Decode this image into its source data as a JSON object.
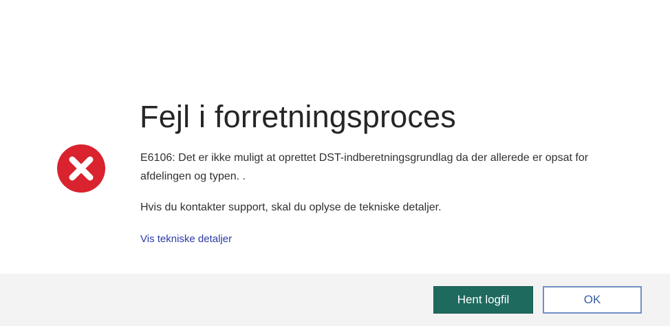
{
  "dialog": {
    "title": "Fejl i forretningsproces",
    "message": "E6106: Det er ikke muligt at oprettet DST-indberetningsgrundlag da der allerede er opsat for afdelingen og typen. .",
    "support_text": "Hvis du kontakter support, skal du oplyse de tekniske detaljer.",
    "details_link": "Vis tekniske detaljer",
    "icon": "error-x-circle-icon"
  },
  "footer": {
    "download_log_label": "Hent logfil",
    "ok_label": "OK"
  },
  "colors": {
    "error_red": "#d9232e",
    "primary_button": "#1f6a5f",
    "link": "#2b3aa6",
    "footer_bg": "#f3f3f3"
  }
}
